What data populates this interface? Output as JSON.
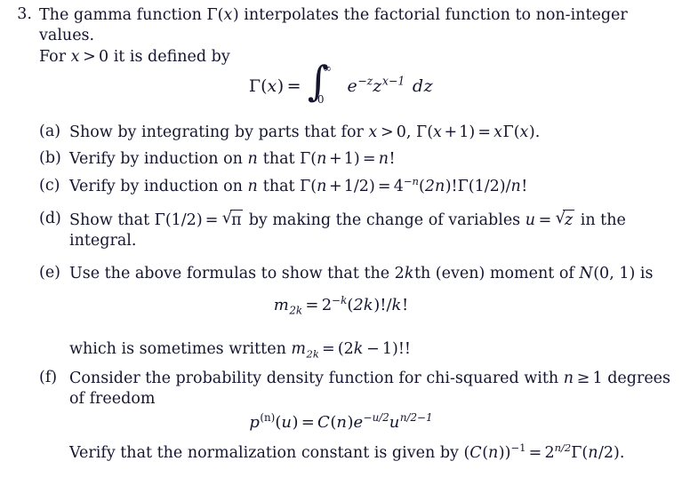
{
  "document": {
    "type": "math-problem-set",
    "background_color": "#ffffff",
    "text_color": "#151530"
  },
  "problem": {
    "number": "3.",
    "line1": "The gamma function Γ(x) interpolates the factorial function to non-integer values.",
    "line2": "For x > 0 it is defined by",
    "statement_plain": "The gamma function Γ(x) interpolates the factorial function to non-integer values. For x > 0 it is defined by",
    "pieces": {
      "l1_a": "The gamma function ",
      "l1_gamma": "Γ",
      "l1_x": "x",
      "l1_b": " interpolates the factorial function to non-integer values.",
      "l2_for": "For ",
      "l2_x": "x",
      "l2_gt": ">",
      "l2_zero": "0",
      "l2_rest": " it is defined by"
    }
  },
  "display_equations": {
    "gamma_integral": {
      "latex": "\\Gamma(x) = \\int_0^\\infty e^{-z} z^{x-1}\\,dz",
      "plain": "Γ(x) = ∫_0^∞ e^{-z} z^{x-1} dz",
      "parts": {
        "gamma": "Γ",
        "lparen": "(",
        "x": "x",
        "rparen": ")",
        "eq": "=",
        "int_sign": "∫",
        "upper_limit": "∞",
        "lower_limit": "0",
        "e": "e",
        "e_exp": "−z",
        "z": "z",
        "z_exp": "x−1",
        "dz_d": "d",
        "dz_z": "z"
      }
    },
    "moment": {
      "latex": "m_{2k} = 2^{-k}(2k)!/k!",
      "plain": "m_2k = 2^{-k}(2k)!/k!",
      "parts": {
        "m": "m",
        "m_sub": "2k",
        "eq": "=",
        "two": "2",
        "two_exp": "−k",
        "lparen": "(",
        "twok": "2k",
        "rparen_bang": ")!/",
        "k": "k",
        "bang": "!"
      }
    },
    "chisq_pdf": {
      "latex": "p^{(n)}(u) = C(n)e^{-u/2}u^{n/2-1}",
      "plain": "p^{(n)}(u) = C(n)e^{-u/2}u^{n/2-1}",
      "parts": {
        "p": "p",
        "p_exp": "(n)",
        "lparen": "(",
        "u": "u",
        "rparen": ")",
        "eq": "=",
        "C": "C",
        "Cn_l": "(",
        "n": "n",
        "Cn_r": ")",
        "e": "e",
        "e_exp": "−u/2",
        "u2": "u",
        "u_exp": "n/2−1"
      }
    }
  },
  "items": [
    {
      "label": "(a)",
      "letter": "a",
      "text_plain": "Show by integrating by parts that for x > 0, Γ(x + 1) = xΓ(x).",
      "parts": {
        "pre": "Show by integrating by parts that for ",
        "x1": "x",
        "gt": ">",
        "zero": "0,",
        "gamma1": "Γ",
        "x2": "x",
        "plus": "+",
        "one": "1",
        "eq": "=",
        "x3": "x",
        "gamma2": "Γ",
        "x4": "x",
        "end": "."
      }
    },
    {
      "label": "(b)",
      "letter": "b",
      "text_plain": "Verify by induction on n that Γ(n + 1) = n!",
      "parts": {
        "pre": "Verify by induction on ",
        "n1": "n",
        "mid": " that ",
        "gamma": "Γ",
        "n2": "n",
        "plus": "+",
        "one": "1",
        "eq": "=",
        "n3": "n",
        "bang": "!"
      }
    },
    {
      "label": "(c)",
      "letter": "c",
      "text_plain": "Verify by induction on n that Γ(n + 1/2) = 4^{-n}(2n)!Γ(1/2)/n!",
      "parts": {
        "pre": "Verify by induction on ",
        "n1": "n",
        "mid": " that ",
        "gamma": "Γ",
        "n2": "n",
        "plus": "+",
        "half": "1/2",
        "eq": "=",
        "four": "4",
        "four_exp": "−n",
        "two_n": "2n",
        "bang1": ")!",
        "gamma2": "Γ",
        "half2": "1/2",
        "slash": "/",
        "n3": "n",
        "bang2": "!"
      }
    },
    {
      "label": "(d)",
      "letter": "d",
      "text_plain": "Show that Γ(1/2) = √π by making the change of variables u = √z in the integral.",
      "parts": {
        "pre": "Show that ",
        "gamma": "Γ",
        "half": "1/2",
        "eq1": "=",
        "pi": "π",
        "mid": " by making the change of variables ",
        "u": "u",
        "eq2": "=",
        "z": "z",
        "tail": " in the",
        "cont": "integral."
      }
    },
    {
      "label": "(e)",
      "letter": "e",
      "text_plain": "Use the above formulas to show that the 2kth (even) moment of N(0, 1) is",
      "parts": {
        "pre": "Use the above formulas to show that the 2",
        "k": "k",
        "mid": "th (even) moment of ",
        "N": "N",
        "args": "(0, 1)",
        "tail": " is"
      }
    },
    {
      "label": "(f)",
      "letter": "f",
      "text_plain": "Consider the probability density function for chi-squared with n ≥ 1 degrees of freedom",
      "parts": {
        "pre": "Consider the probability density function for chi-squared with ",
        "n": "n",
        "ge": "≥",
        "one": "1",
        "tail": " degrees",
        "cont": "of freedom"
      }
    }
  ],
  "extra_lines": {
    "sometimes_written": {
      "text_plain": "which is sometimes written m_2k = (2k − 1)!!",
      "parts": {
        "pre": "which is sometimes written ",
        "m": "m",
        "m_sub": "2k",
        "eq": "=",
        "lparen": "(2",
        "k": "k",
        "minus": "−",
        "one": "1",
        "tail": ")!!"
      }
    },
    "verify_normalization": {
      "text_plain": "Verify that the normalization constant is given by (C(n))^{-1} = 2^{n/2}Γ(n/2).",
      "parts": {
        "pre": "Verify that the normalization constant is given by (",
        "C": "C",
        "lparen": "(",
        "n1": "n",
        "rparen": "))",
        "exp": "−1",
        "eq": "=",
        "two": "2",
        "two_exp": "n/2",
        "gamma": "Γ",
        "n2": "n",
        "tail": "/2)."
      }
    }
  }
}
